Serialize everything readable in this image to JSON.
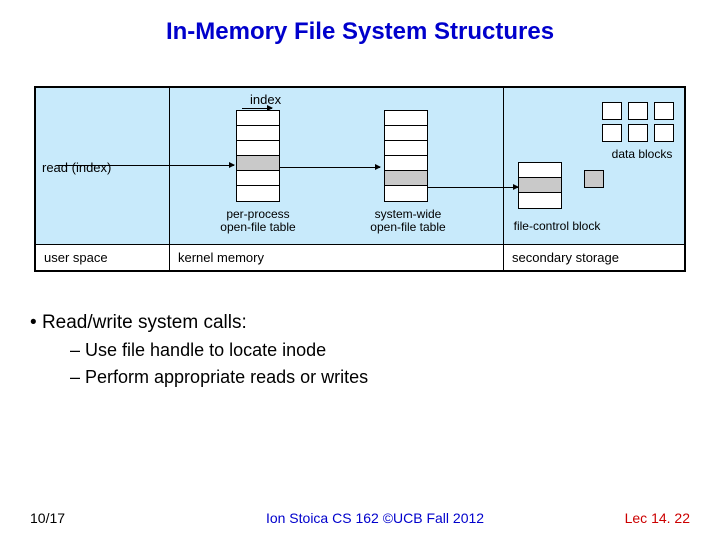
{
  "title": "In-Memory File System Structures",
  "diagram": {
    "index_label": "index",
    "read_label": "read (index)",
    "captions": {
      "per_process": "per-process\nopen-file table",
      "system_wide": "system-wide\nopen-file table",
      "fcb": "file-control block",
      "data_blocks": "data blocks"
    },
    "regions": {
      "user": "user space",
      "kernel": "kernel memory",
      "storage": "secondary storage"
    }
  },
  "bullets": {
    "main": "Read/write system calls:",
    "sub1": "Use file handle to locate inode",
    "sub2": "Perform appropriate reads or writes"
  },
  "footer": {
    "date": "10/17",
    "course": "Ion Stoica CS 162 ©UCB Fall 2012",
    "lec": "Lec 14. 22"
  }
}
